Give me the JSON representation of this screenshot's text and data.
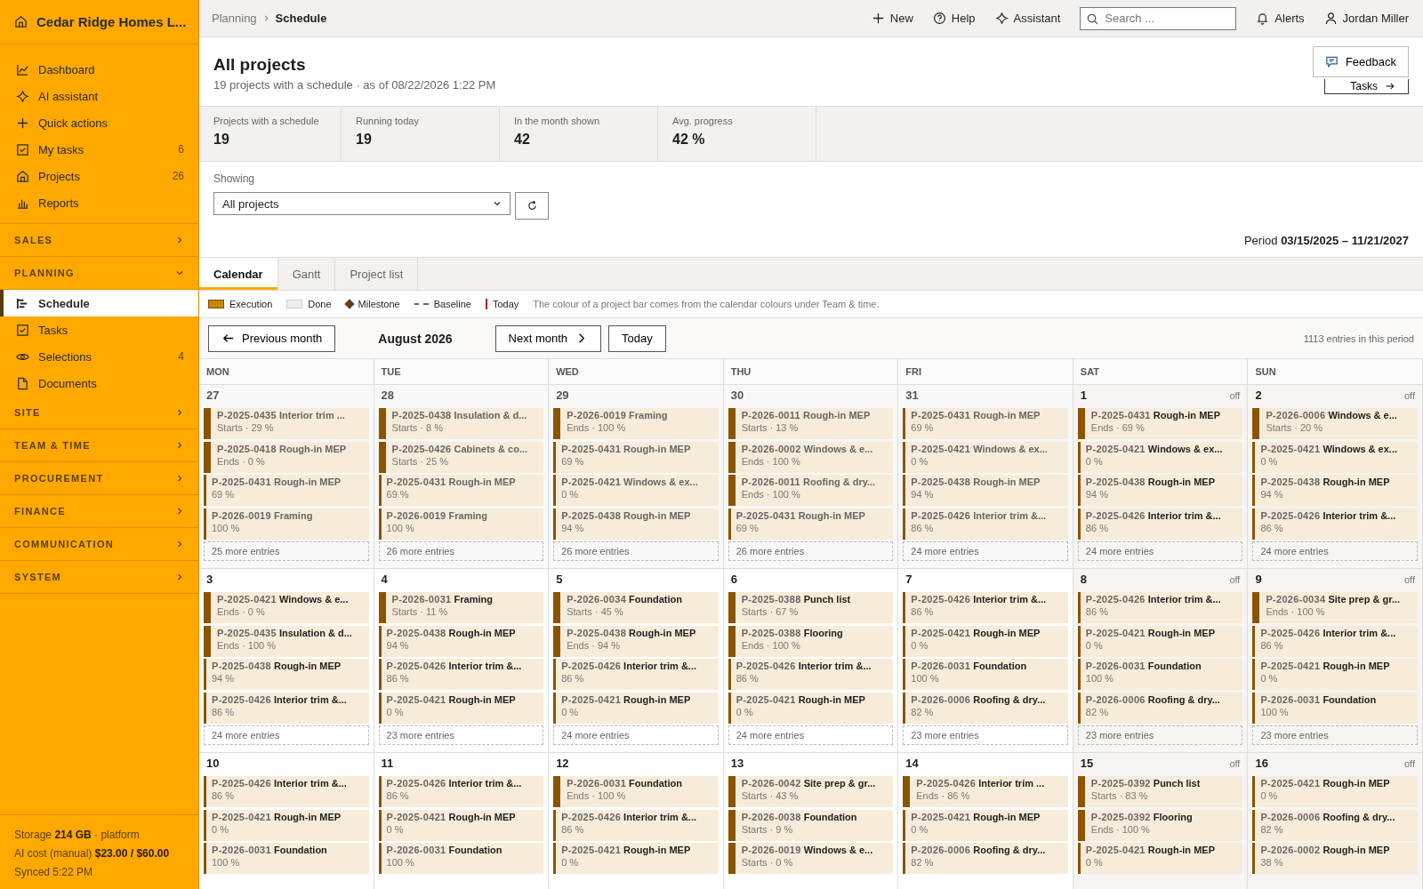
{
  "sidebar": {
    "company": "Cedar Ridge Homes L...",
    "items": [
      {
        "label": "Dashboard"
      },
      {
        "label": "AI assistant"
      },
      {
        "label": "Quick actions"
      },
      {
        "label": "My tasks",
        "count": "6"
      },
      {
        "label": "Projects",
        "count": "26"
      },
      {
        "label": "Reports"
      }
    ],
    "sections": [
      {
        "label": "SALES",
        "expanded": false
      },
      {
        "label": "PLANNING",
        "expanded": true,
        "items": [
          {
            "label": "Schedule",
            "selected": true
          },
          {
            "label": "Tasks",
            "selected": false
          },
          {
            "label": "Selections",
            "count": "4",
            "selected": false
          },
          {
            "label": "Documents",
            "selected": false
          }
        ]
      },
      {
        "label": "SITE",
        "expanded": false
      },
      {
        "label": "TEAM & TIME",
        "expanded": false
      },
      {
        "label": "PROCUREMENT",
        "expanded": false
      },
      {
        "label": "FINANCE",
        "expanded": false
      },
      {
        "label": "COMMUNICATION",
        "expanded": false
      },
      {
        "label": "SYSTEM",
        "expanded": false
      }
    ],
    "footer": [
      "Storage **214 GB** · platform",
      "AI cost (manual) **$23.00 / $60.00**",
      "Synced 5:22 PM"
    ]
  },
  "topbar": {
    "breadcrumb": [
      "Planning",
      "Schedule"
    ],
    "new": "New",
    "help": "Help",
    "assistant": "Assistant",
    "search_placeholder": "Search ...",
    "alerts": "Alerts",
    "user": "Jordan Miller"
  },
  "header": {
    "title": "All projects",
    "subtitle": "19 projects with a schedule · as of 08/22/2026 1:22 PM",
    "feedback": "Feedback",
    "tasks": "Tasks"
  },
  "stats": [
    {
      "label": "Projects with a schedule",
      "value": "19"
    },
    {
      "label": "Running today",
      "value": "19"
    },
    {
      "label": "In the month shown",
      "value": "42"
    },
    {
      "label": "Avg. progress",
      "value": "42 %"
    }
  ],
  "filter": {
    "label": "Showing",
    "value": "All projects",
    "period": "Period **03/15/2025 – 11/21/2027**"
  },
  "tabs": [
    {
      "label": "Calendar",
      "selected": true
    },
    {
      "label": "Gantt",
      "selected": false
    },
    {
      "label": "Project list",
      "selected": false
    }
  ],
  "legend": [
    {
      "kind": "execution",
      "label": "Execution"
    },
    {
      "kind": "done",
      "label": "Done"
    },
    {
      "kind": "milestone",
      "label": "Milestone"
    },
    {
      "kind": "baseline",
      "label": "Baseline"
    },
    {
      "kind": "today",
      "label": "Today"
    }
  ],
  "legend_note": "The colour of a project bar comes from the calendar colours under Team & time.",
  "nav": {
    "previous": "Previous month",
    "month": "August 2026",
    "next": "Next month",
    "today": "Today",
    "count": "1113 entries in this period"
  },
  "weekdays": [
    "MON",
    "TUE",
    "WED",
    "THU",
    "FRI",
    "SAT",
    "SUN"
  ],
  "weeks": [
    {
      "days": [
        {
          "day": "27",
          "past": true,
          "off": false,
          "more": "25 more entries",
          "entries": [
            {
              "id": "P-2025-0435",
              "name": "Interior trim ...",
              "sub": "Starts · 29 %",
              "kind": "start"
            },
            {
              "id": "P-2025-0418",
              "name": "Rough-in MEP",
              "sub": "Ends · 0 %",
              "kind": "end"
            },
            {
              "id": "P-2025-0431",
              "name": "Rough-in MEP",
              "sub": "69 %",
              "kind": "progress"
            },
            {
              "id": "P-2026-0019",
              "name": "Framing",
              "sub": "100 %",
              "kind": "progress"
            }
          ]
        },
        {
          "day": "28",
          "past": true,
          "off": false,
          "more": "26 more entries",
          "entries": [
            {
              "id": "P-2025-0438",
              "name": "Insulation & d...",
              "sub": "Starts · 8 %",
              "kind": "start"
            },
            {
              "id": "P-2025-0426",
              "name": "Cabinets & co...",
              "sub": "Starts · 25 %",
              "kind": "start"
            },
            {
              "id": "P-2025-0431",
              "name": "Rough-in MEP",
              "sub": "69 %",
              "kind": "progress"
            },
            {
              "id": "P-2026-0019",
              "name": "Framing",
              "sub": "100 %",
              "kind": "progress"
            }
          ]
        },
        {
          "day": "29",
          "past": true,
          "off": false,
          "more": "26 more entries",
          "entries": [
            {
              "id": "P-2026-0019",
              "name": "Framing",
              "sub": "Ends · 100 %",
              "kind": "end"
            },
            {
              "id": "P-2025-0431",
              "name": "Rough-in MEP",
              "sub": "69 %",
              "kind": "progress"
            },
            {
              "id": "P-2025-0421",
              "name": "Windows & ex...",
              "sub": "0 %",
              "kind": "progress"
            },
            {
              "id": "P-2025-0438",
              "name": "Rough-in MEP",
              "sub": "94 %",
              "kind": "progress"
            }
          ]
        },
        {
          "day": "30",
          "past": true,
          "off": false,
          "more": "26 more entries",
          "entries": [
            {
              "id": "P-2026-0011",
              "name": "Rough-in MEP",
              "sub": "Starts · 13 %",
              "kind": "start"
            },
            {
              "id": "P-2026-0002",
              "name": "Windows & e...",
              "sub": "Ends · 100 %",
              "kind": "end"
            },
            {
              "id": "P-2026-0011",
              "name": "Roofing & dry...",
              "sub": "Ends · 100 %",
              "kind": "end"
            },
            {
              "id": "P-2025-0431",
              "name": "Rough-in MEP",
              "sub": "69 %",
              "kind": "progress"
            }
          ]
        },
        {
          "day": "31",
          "past": true,
          "off": false,
          "more": "24 more entries",
          "entries": [
            {
              "id": "P-2025-0431",
              "name": "Rough-in MEP",
              "sub": "69 %",
              "kind": "progress"
            },
            {
              "id": "P-2025-0421",
              "name": "Windows & ex...",
              "sub": "0 %",
              "kind": "progress"
            },
            {
              "id": "P-2025-0438",
              "name": "Rough-in MEP",
              "sub": "94 %",
              "kind": "progress"
            },
            {
              "id": "P-2025-0426",
              "name": "Interior trim &...",
              "sub": "86 %",
              "kind": "progress"
            }
          ]
        },
        {
          "day": "1",
          "past": false,
          "off": true,
          "off_label": "off",
          "more": "24 more entries",
          "entries": [
            {
              "id": "P-2025-0431",
              "name": "Rough-in MEP",
              "sub": "Ends · 69 %",
              "kind": "end"
            },
            {
              "id": "P-2025-0421",
              "name": "Windows & ex...",
              "sub": "0 %",
              "kind": "progress"
            },
            {
              "id": "P-2025-0438",
              "name": "Rough-in MEP",
              "sub": "94 %",
              "kind": "progress"
            },
            {
              "id": "P-2025-0426",
              "name": "Interior trim &...",
              "sub": "86 %",
              "kind": "progress"
            }
          ]
        },
        {
          "day": "2",
          "past": false,
          "off": true,
          "off_label": "off",
          "more": "24 more entries",
          "entries": [
            {
              "id": "P-2026-0006",
              "name": "Windows & e...",
              "sub": "Starts · 20 %",
              "kind": "start"
            },
            {
              "id": "P-2025-0421",
              "name": "Windows & ex...",
              "sub": "0 %",
              "kind": "progress"
            },
            {
              "id": "P-2025-0438",
              "name": "Rough-in MEP",
              "sub": "94 %",
              "kind": "progress"
            },
            {
              "id": "P-2025-0426",
              "name": "Interior trim &...",
              "sub": "86 %",
              "kind": "progress"
            }
          ]
        }
      ]
    },
    {
      "days": [
        {
          "day": "3",
          "past": false,
          "off": false,
          "more": "24 more entries",
          "entries": [
            {
              "id": "P-2025-0421",
              "name": "Windows & e...",
              "sub": "Ends · 0 %",
              "kind": "end"
            },
            {
              "id": "P-2025-0435",
              "name": "Insulation & d...",
              "sub": "Ends · 100 %",
              "kind": "end"
            },
            {
              "id": "P-2025-0438",
              "name": "Rough-in MEP",
              "sub": "94 %",
              "kind": "progress"
            },
            {
              "id": "P-2025-0426",
              "name": "Interior trim &...",
              "sub": "86 %",
              "kind": "progress"
            }
          ]
        },
        {
          "day": "4",
          "past": false,
          "off": false,
          "more": "23 more entries",
          "entries": [
            {
              "id": "P-2026-0031",
              "name": "Framing",
              "sub": "Starts · 11 %",
              "kind": "start"
            },
            {
              "id": "P-2025-0438",
              "name": "Rough-in MEP",
              "sub": "94 %",
              "kind": "progress"
            },
            {
              "id": "P-2025-0426",
              "name": "Interior trim &...",
              "sub": "86 %",
              "kind": "progress"
            },
            {
              "id": "P-2025-0421",
              "name": "Rough-in MEP",
              "sub": "0 %",
              "kind": "progress"
            }
          ]
        },
        {
          "day": "5",
          "past": false,
          "off": false,
          "more": "24 more entries",
          "entries": [
            {
              "id": "P-2026-0034",
              "name": "Foundation",
              "sub": "Starts · 45 %",
              "kind": "start"
            },
            {
              "id": "P-2025-0438",
              "name": "Rough-in MEP",
              "sub": "Ends · 94 %",
              "kind": "end"
            },
            {
              "id": "P-2025-0426",
              "name": "Interior trim &...",
              "sub": "86 %",
              "kind": "progress"
            },
            {
              "id": "P-2025-0421",
              "name": "Rough-in MEP",
              "sub": "0 %",
              "kind": "progress"
            }
          ]
        },
        {
          "day": "6",
          "past": false,
          "off": false,
          "more": "24 more entries",
          "entries": [
            {
              "id": "P-2025-0388",
              "name": "Punch list",
              "sub": "Starts · 67 %",
              "kind": "start"
            },
            {
              "id": "P-2025-0388",
              "name": "Flooring",
              "sub": "Ends · 100 %",
              "kind": "end"
            },
            {
              "id": "P-2025-0426",
              "name": "Interior trim &...",
              "sub": "86 %",
              "kind": "progress"
            },
            {
              "id": "P-2025-0421",
              "name": "Rough-in MEP",
              "sub": "0 %",
              "kind": "progress"
            }
          ]
        },
        {
          "day": "7",
          "past": false,
          "off": false,
          "more": "23 more entries",
          "entries": [
            {
              "id": "P-2025-0426",
              "name": "Interior trim &...",
              "sub": "86 %",
              "kind": "progress"
            },
            {
              "id": "P-2025-0421",
              "name": "Rough-in MEP",
              "sub": "0 %",
              "kind": "progress"
            },
            {
              "id": "P-2026-0031",
              "name": "Foundation",
              "sub": "100 %",
              "kind": "progress"
            },
            {
              "id": "P-2026-0006",
              "name": "Roofing & dry...",
              "sub": "82 %",
              "kind": "progress"
            }
          ]
        },
        {
          "day": "8",
          "past": false,
          "off": true,
          "off_label": "off",
          "more": "23 more entries",
          "entries": [
            {
              "id": "P-2025-0426",
              "name": "Interior trim &...",
              "sub": "86 %",
              "kind": "progress"
            },
            {
              "id": "P-2025-0421",
              "name": "Rough-in MEP",
              "sub": "0 %",
              "kind": "progress"
            },
            {
              "id": "P-2026-0031",
              "name": "Foundation",
              "sub": "100 %",
              "kind": "progress"
            },
            {
              "id": "P-2026-0006",
              "name": "Roofing & dry...",
              "sub": "82 %",
              "kind": "progress"
            }
          ]
        },
        {
          "day": "9",
          "past": false,
          "off": true,
          "off_label": "off",
          "more": "23 more entries",
          "entries": [
            {
              "id": "P-2026-0034",
              "name": "Site prep & gr...",
              "sub": "Ends · 100 %",
              "kind": "end"
            },
            {
              "id": "P-2025-0426",
              "name": "Interior trim &...",
              "sub": "86 %",
              "kind": "progress"
            },
            {
              "id": "P-2025-0421",
              "name": "Rough-in MEP",
              "sub": "0 %",
              "kind": "progress"
            },
            {
              "id": "P-2026-0031",
              "name": "Foundation",
              "sub": "100 %",
              "kind": "progress"
            }
          ]
        }
      ]
    },
    {
      "days": [
        {
          "day": "10",
          "past": false,
          "off": false,
          "entries": [
            {
              "id": "P-2025-0426",
              "name": "Interior trim &...",
              "sub": "86 %",
              "kind": "progress"
            },
            {
              "id": "P-2025-0421",
              "name": "Rough-in MEP",
              "sub": "0 %",
              "kind": "progress"
            },
            {
              "id": "P-2026-0031",
              "name": "Foundation",
              "sub": "100 %",
              "kind": "progress"
            }
          ]
        },
        {
          "day": "11",
          "past": false,
          "off": false,
          "entries": [
            {
              "id": "P-2025-0426",
              "name": "Interior trim &...",
              "sub": "86 %",
              "kind": "progress"
            },
            {
              "id": "P-2025-0421",
              "name": "Rough-in MEP",
              "sub": "0 %",
              "kind": "progress"
            },
            {
              "id": "P-2026-0031",
              "name": "Foundation",
              "sub": "100 %",
              "kind": "progress"
            }
          ]
        },
        {
          "day": "12",
          "past": false,
          "off": false,
          "entries": [
            {
              "id": "P-2026-0031",
              "name": "Foundation",
              "sub": "Ends · 100 %",
              "kind": "end"
            },
            {
              "id": "P-2025-0426",
              "name": "Interior trim &...",
              "sub": "86 %",
              "kind": "progress"
            },
            {
              "id": "P-2025-0421",
              "name": "Rough-in MEP",
              "sub": "0 %",
              "kind": "progress"
            }
          ]
        },
        {
          "day": "13",
          "past": false,
          "off": false,
          "entries": [
            {
              "id": "P-2026-0042",
              "name": "Site prep & gr...",
              "sub": "Starts · 43 %",
              "kind": "start"
            },
            {
              "id": "P-2026-0038",
              "name": "Foundation",
              "sub": "Starts · 9 %",
              "kind": "start"
            },
            {
              "id": "P-2026-0019",
              "name": "Windows & e...",
              "sub": "Starts · 0 %",
              "kind": "start"
            }
          ]
        },
        {
          "day": "14",
          "past": false,
          "off": false,
          "entries": [
            {
              "id": "P-2025-0426",
              "name": "Interior trim ...",
              "sub": "Ends · 86 %",
              "kind": "end"
            },
            {
              "id": "P-2025-0421",
              "name": "Rough-in MEP",
              "sub": "0 %",
              "kind": "progress"
            },
            {
              "id": "P-2026-0006",
              "name": "Roofing & dry...",
              "sub": "82 %",
              "kind": "progress"
            }
          ]
        },
        {
          "day": "15",
          "past": false,
          "off": true,
          "off_label": "off",
          "entries": [
            {
              "id": "P-2025-0392",
              "name": "Punch list",
              "sub": "Starts · 83 %",
              "kind": "start"
            },
            {
              "id": "P-2025-0392",
              "name": "Flooring",
              "sub": "Ends · 100 %",
              "kind": "end"
            },
            {
              "id": "P-2025-0421",
              "name": "Rough-in MEP",
              "sub": "0 %",
              "kind": "progress"
            }
          ]
        },
        {
          "day": "16",
          "past": false,
          "off": true,
          "off_label": "off",
          "entries": [
            {
              "id": "P-2025-0421",
              "name": "Rough-in MEP",
              "sub": "0 %",
              "kind": "progress"
            },
            {
              "id": "P-2026-0006",
              "name": "Roofing & dry...",
              "sub": "82 %",
              "kind": "progress"
            },
            {
              "id": "P-2026-0002",
              "name": "Rough-in MEP",
              "sub": "38 %",
              "kind": "progress"
            }
          ]
        }
      ]
    }
  ]
}
